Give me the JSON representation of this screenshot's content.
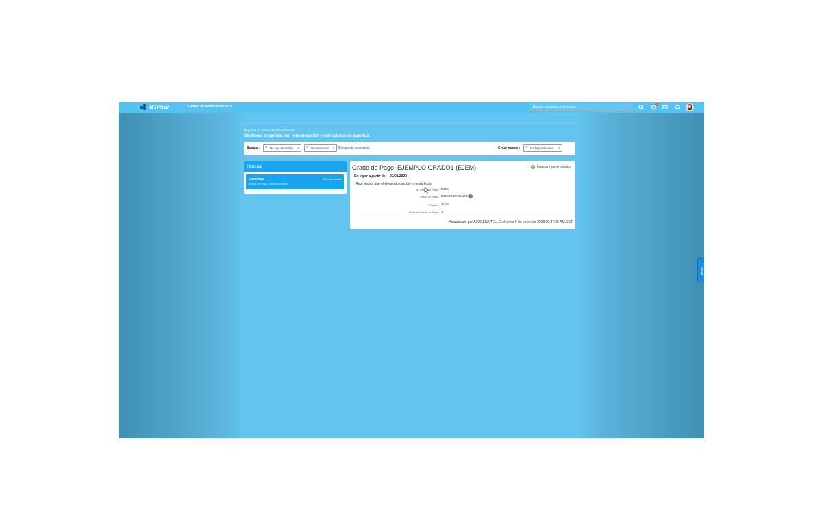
{
  "app": {
    "name": "iGrow",
    "admin_menu": "Centro de administración ▾"
  },
  "topbar": {
    "search_placeholder": "Buscar acciones o personas",
    "notification_count": "1",
    "icons": [
      "search-icon",
      "approvals-icon",
      "inbox-icon",
      "bell-icon",
      "avatar"
    ]
  },
  "breadcrumb": "Regresar a: Centro de administración",
  "page_title": "Gestionar organización, remuneración y estructuras de puestos",
  "searchbar": {
    "search_label": "Buscar :",
    "select1": "No hay selección",
    "select2": "Sin selección",
    "advanced": "Búsqueda avanzada",
    "create_label": "Crear nuevo :",
    "create_select": "No hay selección"
  },
  "history": {
    "title": "Historial",
    "item_date": "01/01/2023",
    "item_sub": "Grado de Pago: Registro creado",
    "item_delete": "Eliminar acción"
  },
  "detail": {
    "title": "Grado de Pago: EJEMPLO GRADO1 (EJEM)",
    "insert": "Insertar nuevo registro",
    "effective_label_a": "En vigor a",
    "effective_label_b": "partir",
    "effective_label_c": "de",
    "effective_date": "01/01/2023",
    "legend_blue": "Azul",
    "legend_text": "indica que el elemento cambió en esta fecha",
    "fields": [
      {
        "label": "ID Grado de Pago:",
        "value": "EJEM"
      },
      {
        "label": "Grado de Pago:",
        "value": "EJEMPLO GRADO1"
      },
      {
        "label": "Estado:",
        "value": "Activo"
      },
      {
        "label": "Nivel de Grado de Pago:",
        "value": "1"
      }
    ],
    "updated": "Actualizado por AZUCENA TELLO el lunes 9 de enero de 2023 09:47:35 AM CST"
  },
  "side_tab": "Ayuda",
  "colors": {
    "topbar": "#54c3f3",
    "accent": "#18a4ee",
    "link": "#1b6fb0",
    "insert_green": "#6ab04c"
  }
}
